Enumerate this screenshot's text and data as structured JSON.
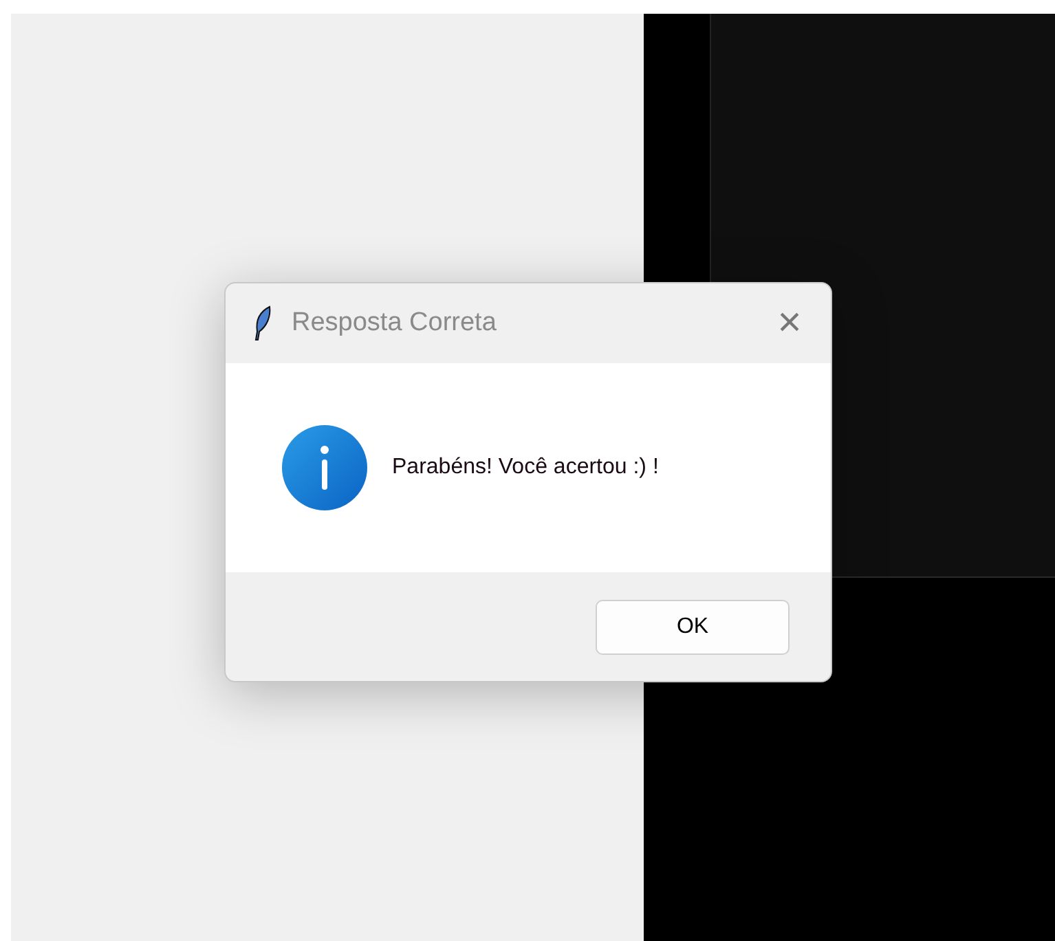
{
  "dialog": {
    "title": "Resposta Correta",
    "close_glyph": "×",
    "message": "Parabéns! Você acertou :) !",
    "buttons": [
      "OK"
    ]
  }
}
